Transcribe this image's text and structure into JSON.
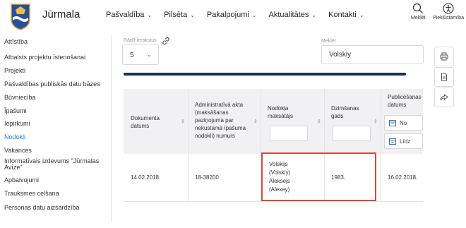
{
  "header": {
    "brand": "Jūrmala",
    "nav": [
      {
        "label": "Pašvaldība"
      },
      {
        "label": "Pilsēta"
      },
      {
        "label": "Pakalpojumi"
      },
      {
        "label": "Aktualitātes"
      },
      {
        "label": "Kontakti"
      }
    ],
    "search_label": "Meklēt",
    "accessibility_label": "Piekļūstamība"
  },
  "sidebar": {
    "items": [
      {
        "label": "Attīstība"
      },
      {
        "label": "Atbalsts projektu īstenošanai"
      },
      {
        "label": "Projekti"
      },
      {
        "label": "Pašvaldības publiskās datu bāzes"
      },
      {
        "label": "Būvniecība"
      },
      {
        "label": "Īpašumi"
      },
      {
        "label": "Iepirkumi"
      },
      {
        "label": "Nodokļi"
      },
      {
        "label": "Vakances"
      },
      {
        "label": "Informatīvais izdevums \"Jūrmalas Avīze\""
      },
      {
        "label": "Apbalvojumi"
      },
      {
        "label": "Trauksmes celšana"
      },
      {
        "label": "Personas datu aizsardzība"
      }
    ],
    "active_index": 7
  },
  "filters": {
    "records_label": "Rādīt ierakstus",
    "records_value": "5",
    "search_label": "Meklēt",
    "search_value": "Volskiy"
  },
  "progress": {
    "fraction": 1.0
  },
  "table": {
    "columns": [
      {
        "label": "Dokumenta datums"
      },
      {
        "label": "Administratīvā akta (maksāšanas paziņojuma par nekustamā īpašuma nodokli) numurs"
      },
      {
        "label": "Nodokļa maksātājs"
      },
      {
        "label": "Dzimšanas gads"
      },
      {
        "label": "Publicēšanas datums"
      }
    ],
    "date_filter_from": "No",
    "date_filter_to": "Līdz",
    "rows": [
      {
        "doc_date": "14.02.2018.",
        "act_number": "18-38200",
        "payer": "Volskijs (Volskiy) Aleksejs (Alexey)",
        "birth_year": "1983.",
        "published": "16.02.2018."
      }
    ]
  },
  "colors": {
    "accent": "#2a7fd4",
    "progress": "#1c2f55",
    "highlight": "#d9463e",
    "header_bg": "#f1f1f3"
  }
}
